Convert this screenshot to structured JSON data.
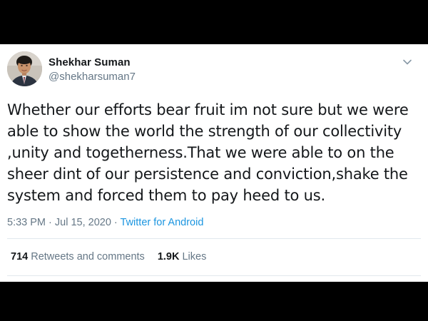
{
  "user": {
    "display_name": "Shekhar Suman",
    "handle": "@shekharsuman7"
  },
  "tweet": {
    "lines": [
      "Whether our efforts bear fruit im not sure but we were",
      "able to show the world the strength of our collectivity",
      ",unity and togetherness.That we were able to on the",
      "sheer dint of our persistence and conviction,shake the",
      "system and forced them to pay heed to us."
    ]
  },
  "meta": {
    "time": "5:33 PM",
    "separator": " · ",
    "date": "Jul 15, 2020",
    "source": "Twitter for Android"
  },
  "stats": {
    "retweets_count": "714",
    "retweets_label": "Retweets and comments",
    "likes_count": "1.9K",
    "likes_label": "Likes"
  },
  "icons": {
    "caret": "chevron-down-icon",
    "avatar": "avatar"
  },
  "colors": {
    "text": "#14171a",
    "secondary": "#657786",
    "link": "#1b95e0",
    "divider": "#e1e8ed",
    "letterbox": "#000000"
  }
}
